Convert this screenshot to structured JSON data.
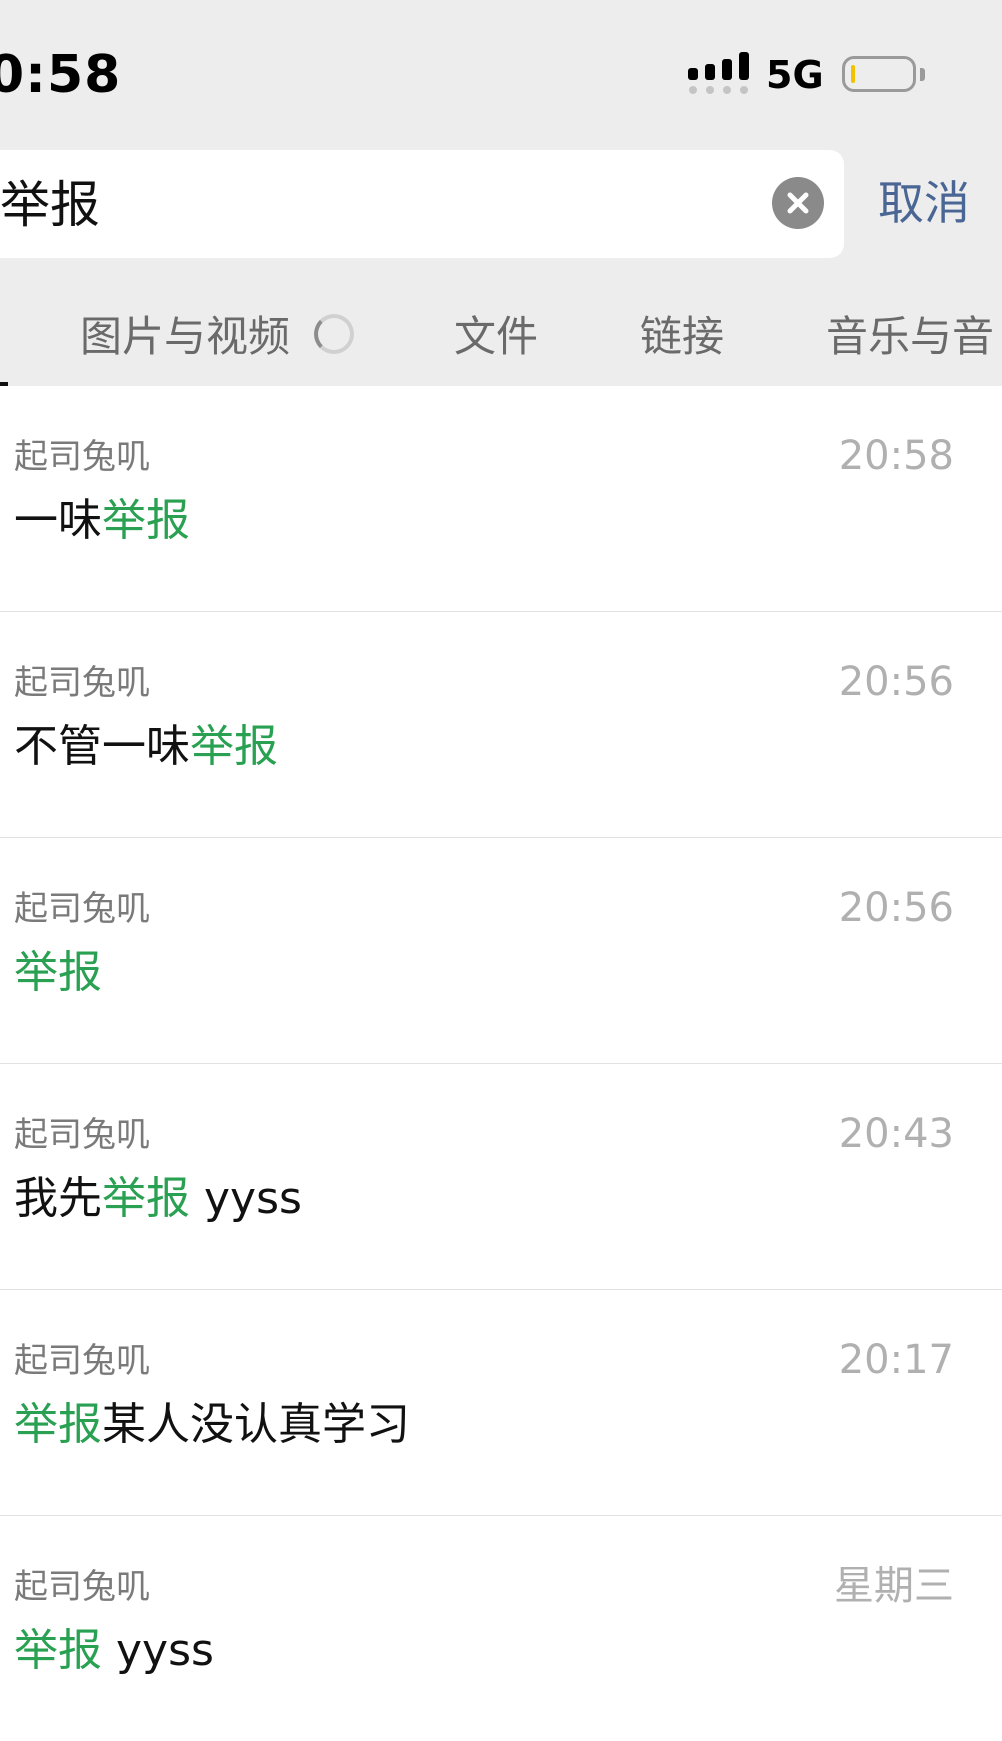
{
  "status_bar": {
    "time": "0:58",
    "network": "5G",
    "signal_icon": "cellular-signal-icon",
    "battery_icon": "battery-low-icon",
    "battery_level_fraction": 0.05
  },
  "search": {
    "query": "举报",
    "clear_icon": "clear-x-icon",
    "cancel_label": "取消"
  },
  "tabs": [
    {
      "label": "图片与视频"
    },
    {
      "label": "文件"
    },
    {
      "label": "链接"
    },
    {
      "label": "音乐与音"
    }
  ],
  "results": [
    {
      "sender": "起司兔叽",
      "time": "20:58",
      "prefix": "一味",
      "match": "举报",
      "suffix": ""
    },
    {
      "sender": "起司兔叽",
      "time": "20:56",
      "prefix": "不管一味",
      "match": "举报",
      "suffix": ""
    },
    {
      "sender": "起司兔叽",
      "time": "20:56",
      "prefix": "",
      "match": "举报",
      "suffix": ""
    },
    {
      "sender": "起司兔叽",
      "time": "20:43",
      "prefix": "我先",
      "match": "举报",
      "suffix": " yyss"
    },
    {
      "sender": "起司兔叽",
      "time": "20:17",
      "prefix": "",
      "match": "举报",
      "suffix": "某人没认真学习"
    },
    {
      "sender": "起司兔叽",
      "time": "星期三",
      "prefix": "",
      "match": "举报",
      "suffix": " yyss"
    }
  ],
  "colors": {
    "highlight": "#2aa152",
    "cancel": "#4a6695",
    "background_top": "#ededed"
  }
}
